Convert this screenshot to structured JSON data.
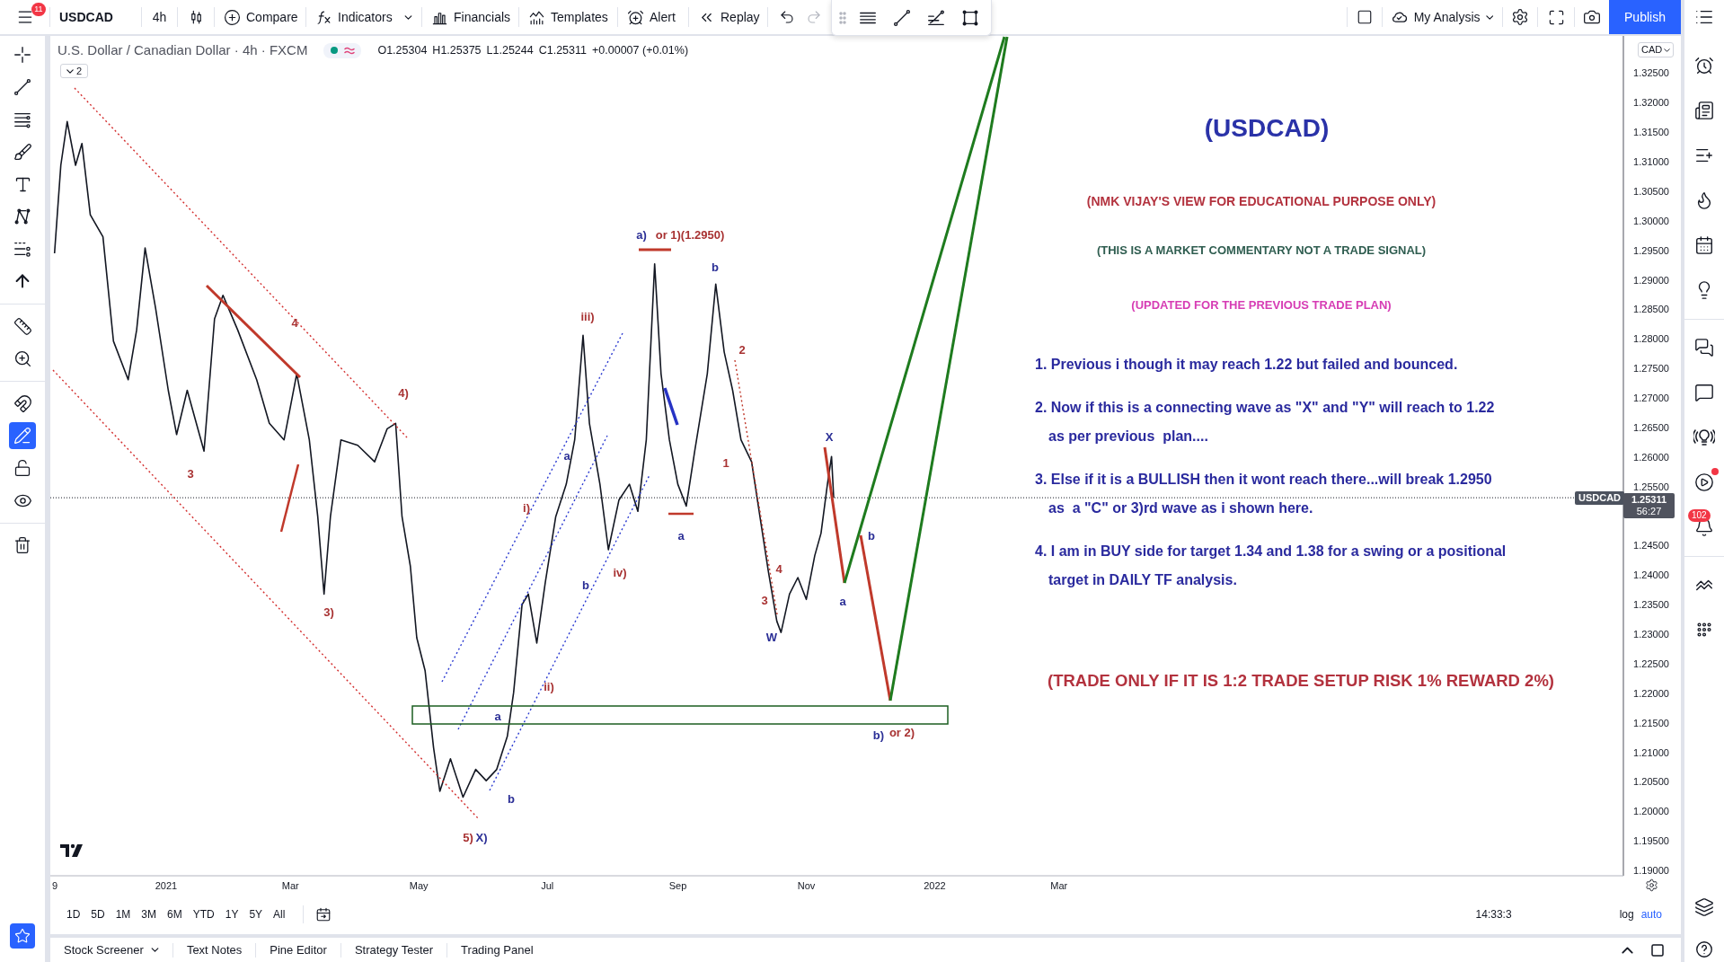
{
  "top_bar": {
    "menu_badge": "11",
    "symbol": "USDCAD",
    "interval": "4h",
    "buttons": [
      "Compare",
      "Indicators",
      "Financials",
      "Templates",
      "Alert",
      "Replay"
    ],
    "undo": {
      "disabled": false
    },
    "redo": {
      "disabled": true
    },
    "layout_name": "My Analysis",
    "publish_button": "Publish"
  },
  "left_toolbar": {
    "tools": [
      {
        "on": false
      },
      {
        "on": false
      },
      {
        "on": false
      },
      {
        "on": false
      },
      {
        "on": false
      },
      {
        "on": false
      },
      {
        "on": false
      },
      {
        "on": false
      },
      {
        "on": false
      },
      {
        "on": false
      },
      {
        "on": false
      },
      {
        "on": true
      },
      {
        "on": false
      },
      {
        "on": false
      },
      {
        "on": false
      }
    ]
  },
  "chart": {
    "legend": {
      "title": "U.S. Dollar / Canadian Dollar · 4h · FXCM",
      "values": [
        "O1.25304",
        "H1.25375",
        "L1.25244",
        "C1.25311",
        "+0.00007 (+0.01%)"
      ]
    },
    "collapse_button": "2",
    "currency": "CAD",
    "last_price": {
      "symbol": "USDCAD",
      "price": "1.25311",
      "countdown": "56:27"
    },
    "chart_data": [
      {
        "type": "line",
        "color": "#131722",
        "xlim": [
          "2020-11-07",
          "2022-11-24"
        ],
        "ylim": [
          1.1891,
          1.3313
        ],
        "xticks": [
          {
            "value": "2020-11-09",
            "label": "9"
          },
          {
            "value": "2021-01-01",
            "label": "2021"
          },
          {
            "value": "2021-03-01",
            "label": "Mar"
          },
          {
            "value": "2021-05-01",
            "label": "May"
          },
          {
            "value": "2021-07-01",
            "label": "Jul"
          },
          {
            "value": "2021-09-01",
            "label": "Sep"
          },
          {
            "value": "2021-11-01",
            "label": "Nov"
          },
          {
            "value": "2022-01-01",
            "label": "2022"
          },
          {
            "value": "2022-03-01",
            "label": "Mar"
          }
        ],
        "yticks": [
          {
            "value": 1.325,
            "label": "1.32500"
          },
          {
            "value": 1.32,
            "label": "1.32000"
          },
          {
            "value": 1.315,
            "label": "1.31500"
          },
          {
            "value": 1.31,
            "label": "1.31000"
          },
          {
            "value": 1.305,
            "label": "1.30500"
          },
          {
            "value": 1.3,
            "label": "1.30000"
          },
          {
            "value": 1.295,
            "label": "1.29500"
          },
          {
            "value": 1.29,
            "label": "1.29000"
          },
          {
            "value": 1.285,
            "label": "1.28500"
          },
          {
            "value": 1.28,
            "label": "1.28000"
          },
          {
            "value": 1.275,
            "label": "1.27500"
          },
          {
            "value": 1.27,
            "label": "1.27000"
          },
          {
            "value": 1.265,
            "label": "1.26500"
          },
          {
            "value": 1.26,
            "label": "1.26000"
          },
          {
            "value": 1.255,
            "label": "1.25500"
          },
          {
            "value": 1.245,
            "label": "1.24500"
          },
          {
            "value": 1.24,
            "label": "1.24000"
          },
          {
            "value": 1.235,
            "label": "1.23500"
          },
          {
            "value": 1.23,
            "label": "1.23000"
          },
          {
            "value": 1.225,
            "label": "1.22500"
          },
          {
            "value": 1.22,
            "label": "1.22000"
          },
          {
            "value": 1.215,
            "label": "1.21500"
          },
          {
            "value": 1.21,
            "label": "1.21000"
          },
          {
            "value": 1.205,
            "label": "1.20500"
          },
          {
            "value": 1.2,
            "label": "1.20000"
          },
          {
            "value": 1.195,
            "label": "1.19500"
          },
          {
            "value": 1.19,
            "label": "1.19000"
          }
        ],
        "ref_lines": [
          {
            "axis": "y",
            "value": 1.25311,
            "color": "#131722",
            "line_style": "dotted"
          }
        ],
        "x": [
          "2020-11-09",
          "2020-11-12",
          "2020-11-15",
          "2020-11-19",
          "2020-11-22",
          "2020-11-26",
          "2020-12-02",
          "2020-12-07",
          "2020-12-14",
          "2020-12-18",
          "2020-12-22",
          "2020-12-27",
          "2021-01-02",
          "2021-01-06",
          "2021-01-11",
          "2021-01-19",
          "2021-01-24",
          "2021-01-28",
          "2021-02-04",
          "2021-02-13",
          "2021-02-19",
          "2021-02-26",
          "2021-03-04",
          "2021-03-10",
          "2021-03-14",
          "2021-03-17",
          "2021-03-20",
          "2021-03-25",
          "2021-04-02",
          "2021-04-10",
          "2021-04-16",
          "2021-04-20",
          "2021-04-23",
          "2021-04-27",
          "2021-04-30",
          "2021-05-04",
          "2021-05-08",
          "2021-05-11",
          "2021-05-16",
          "2021-05-22",
          "2021-05-28",
          "2021-06-02",
          "2021-06-07",
          "2021-06-12",
          "2021-06-15",
          "2021-06-19",
          "2021-06-22",
          "2021-06-26",
          "2021-06-30",
          "2021-07-05",
          "2021-07-10",
          "2021-07-14",
          "2021-07-18",
          "2021-07-21",
          "2021-07-26",
          "2021-07-30",
          "2021-08-04",
          "2021-08-09",
          "2021-08-13",
          "2021-08-17",
          "2021-08-21",
          "2021-08-24",
          "2021-08-28",
          "2021-09-01",
          "2021-09-05",
          "2021-09-09",
          "2021-09-15",
          "2021-09-19",
          "2021-09-23",
          "2021-09-27",
          "2021-10-01",
          "2021-10-06",
          "2021-10-10",
          "2021-10-14",
          "2021-10-18",
          "2021-10-20",
          "2021-10-24",
          "2021-10-28",
          "2021-11-01",
          "2021-11-05",
          "2021-11-08",
          "2021-11-11",
          "2021-11-13",
          "2021-11-14"
        ],
        "values": [
          1.2945,
          1.3094,
          1.3168,
          1.3094,
          1.3131,
          1.301,
          1.2973,
          1.2796,
          1.2731,
          1.2815,
          1.2954,
          1.2852,
          1.2713,
          1.2638,
          1.2713,
          1.261,
          1.2834,
          1.2874,
          1.2815,
          1.2731,
          1.2657,
          1.2629,
          1.2741,
          1.2629,
          1.2499,
          1.2368,
          1.2499,
          1.2629,
          1.262,
          1.2592,
          1.2648,
          1.2657,
          1.2499,
          1.2415,
          1.2294,
          1.2238,
          1.2108,
          1.2034,
          1.2089,
          1.2024,
          1.2071,
          1.2052,
          1.2071,
          1.2127,
          1.2201,
          1.235,
          1.2368,
          1.2285,
          1.2387,
          1.2499,
          1.2554,
          1.2629,
          1.2806,
          1.2657,
          1.2554,
          1.2443,
          1.2527,
          1.2554,
          1.2508,
          1.2629,
          1.2927,
          1.2741,
          1.2629,
          1.2554,
          1.2517,
          1.261,
          1.2741,
          1.2893,
          1.2778,
          1.2713,
          1.2629,
          1.2592,
          1.2499,
          1.2406,
          1.2322,
          1.2303,
          1.2368,
          1.2396,
          1.2359,
          1.2433,
          1.2471,
          1.2554,
          1.2601,
          1.2531
        ]
      }
    ],
    "wave_labels": [
      {
        "text": "4",
        "color": "#a83232"
      },
      {
        "text": "3",
        "color": "#a83232"
      },
      {
        "text": "4)",
        "color": "#a83232"
      },
      {
        "text": "3)",
        "color": "#a83232"
      },
      {
        "text": "5)",
        "color": "#a83232"
      },
      {
        "text": "X)",
        "color": "#2b2f96"
      },
      {
        "text": "a",
        "color": "#2b2f96"
      },
      {
        "text": "b",
        "color": "#2b2f96"
      },
      {
        "text": "i)",
        "color": "#a83232"
      },
      {
        "text": "ii)",
        "color": "#a83232"
      },
      {
        "text": "a",
        "color": "#2b2f96"
      },
      {
        "text": "b",
        "color": "#2b2f96"
      },
      {
        "text": "iii)",
        "color": "#a83232"
      },
      {
        "text": "iv)",
        "color": "#a83232"
      },
      {
        "text": "a)",
        "color": "#2b2f96"
      },
      {
        "text": "or 1)(1.2950)",
        "color": "#a83232"
      },
      {
        "text": "b",
        "color": "#2b2f96"
      },
      {
        "text": "a",
        "color": "#2b2f96"
      },
      {
        "text": "1",
        "color": "#a83232"
      },
      {
        "text": "2",
        "color": "#a83232"
      },
      {
        "text": "3",
        "color": "#a83232"
      },
      {
        "text": "4",
        "color": "#a83232"
      },
      {
        "text": "W",
        "color": "#2b2f96"
      },
      {
        "text": "X",
        "color": "#2b2f96"
      },
      {
        "text": "a",
        "color": "#2b2f96"
      },
      {
        "text": "b",
        "color": "#2b2f96"
      },
      {
        "text": "b)",
        "color": "#2b2f96"
      },
      {
        "text": "or 2)",
        "color": "#a83232"
      }
    ],
    "notes": [
      {
        "kind": "title",
        "text": "(USDCAD)",
        "color": "#2a32a8"
      },
      {
        "kind": "banner",
        "text": "(NMK VIJAY'S VIEW FOR EDUCATIONAL PURPOSE ONLY)",
        "color": "#b3323e"
      },
      {
        "kind": "banner",
        "text": "(THIS IS A MARKET COMMENTARY NOT A TRADE SIGNAL)",
        "color": "#2f5d50"
      },
      {
        "kind": "banner",
        "text": "(UPDATED FOR THE PREVIOUS TRADE PLAN)",
        "color": "#d63cb4"
      },
      {
        "kind": "item",
        "lines": [
          "1. Previous i though it may reach 1.22 but failed and bounced."
        ],
        "color": "#2a2a9e"
      },
      {
        "kind": "item",
        "lines": [
          "2. Now if this is a connecting wave as \"X\" and \"Y\" will reach to 1.22",
          "as per previous  plan...."
        ],
        "color": "#2a2a9e"
      },
      {
        "kind": "item",
        "lines": [
          "3. Else if it is a BULLISH then it wont reach there...will break 1.2950",
          "as  a \"C\" or 3)rd wave as i shown here."
        ],
        "color": "#2a2a9e"
      },
      {
        "kind": "item",
        "lines": [
          "4. I am in BUY side for target 1.34 and 1.38 for a swing or a positional",
          "target in DAILY TF analysis."
        ],
        "color": "#2a2a9e"
      },
      {
        "kind": "warning",
        "text": "(TRADE ONLY IF IT IS 1:2 TRADE SETUP RISK 1% REWARD 2%)",
        "color": "#b3323e"
      }
    ]
  },
  "range_bar": {
    "ranges": [
      "1D",
      "5D",
      "1M",
      "3M",
      "6M",
      "YTD",
      "1Y",
      "5Y",
      "All"
    ],
    "time": "14:33:3",
    "scale_options": [
      {
        "label": "log",
        "on": false
      },
      {
        "label": "auto",
        "on": true
      }
    ]
  },
  "bottom_panel": {
    "tabs": [
      "Stock Screener",
      "Text Notes",
      "Pine Editor",
      "Strategy Tester",
      "Trading Panel"
    ]
  },
  "right_toolbar": {
    "badge": "102",
    "dot": true
  }
}
